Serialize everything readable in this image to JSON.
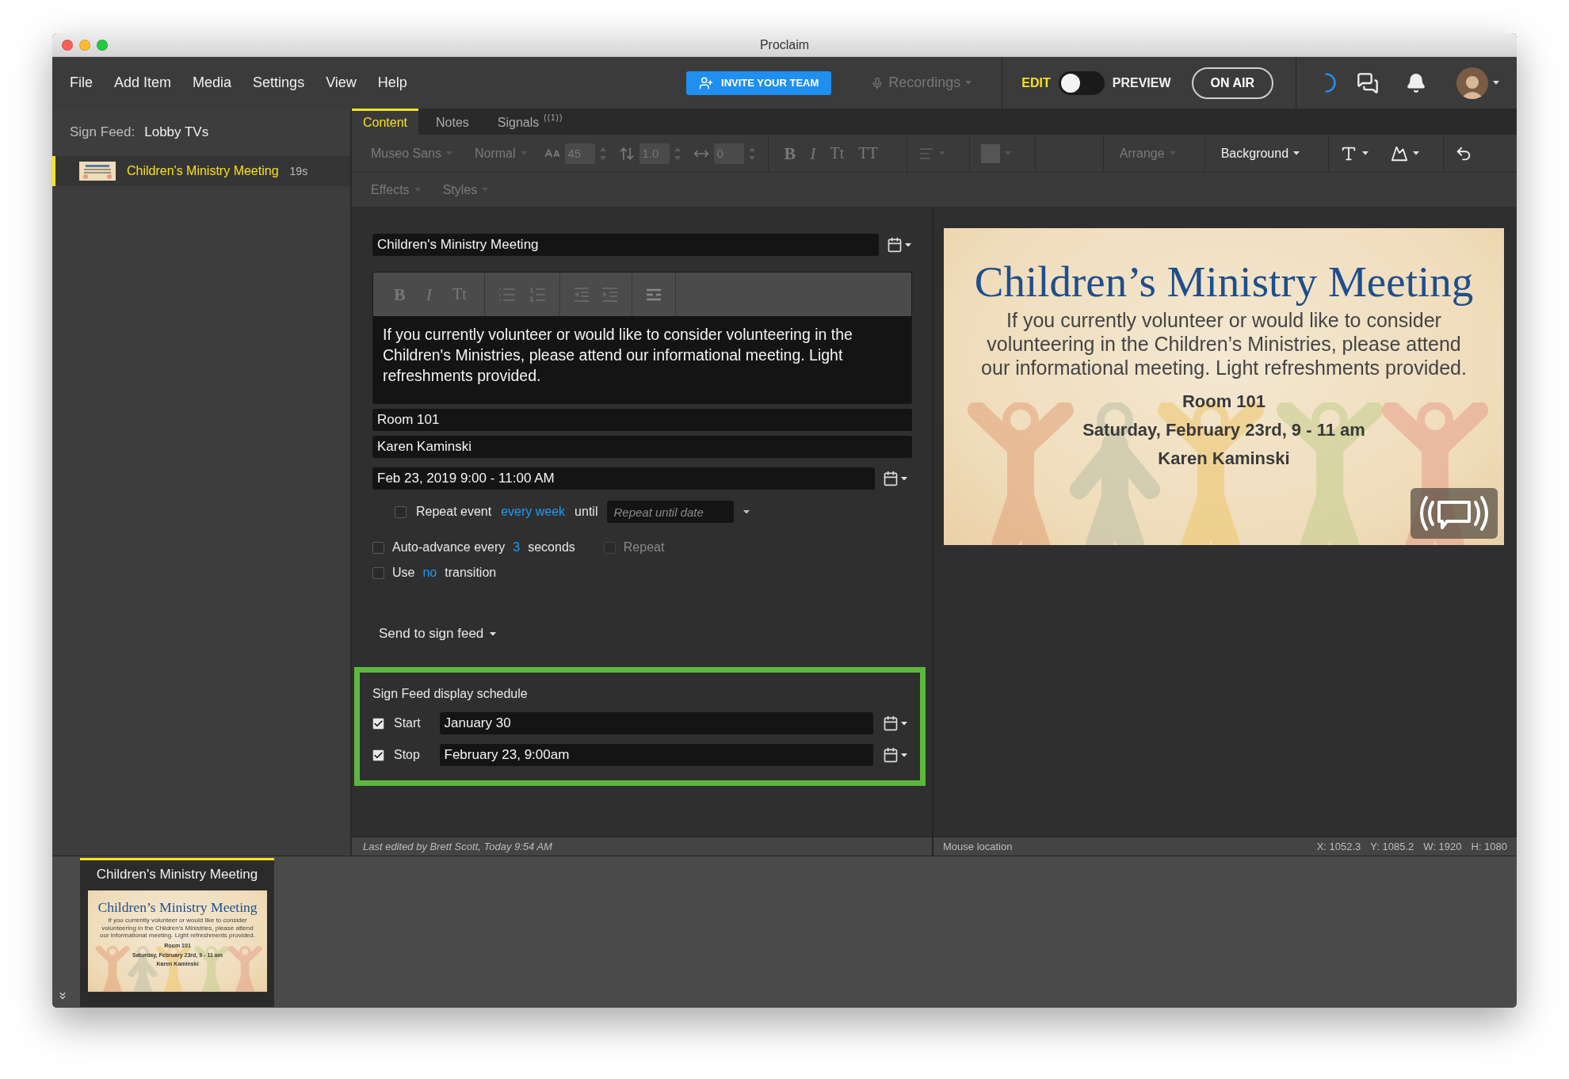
{
  "window": {
    "title": "Proclaim"
  },
  "menu": [
    "File",
    "Add Item",
    "Media",
    "Settings",
    "View",
    "Help"
  ],
  "toolbar": {
    "invite_button": "INVITE YOUR TEAM",
    "recordings": {
      "label": "Recordings",
      "disabled": true
    },
    "edit_label": "EDIT",
    "preview_label": "PREVIEW",
    "mode_toggle": {
      "preview": false
    },
    "on_air_button": "ON AIR"
  },
  "sidebar": {
    "feed_label": "Sign Feed:",
    "feed_name": "Lobby TVs",
    "items": [
      {
        "title": "Children's Ministry Meeting",
        "duration": "19s",
        "selected": true
      }
    ]
  },
  "tabs": [
    {
      "label": "Content",
      "selected": true
    },
    {
      "label": "Notes",
      "selected": false
    },
    {
      "label": "Signals",
      "badge": "((1))",
      "selected": false
    }
  ],
  "format_toolbar": {
    "disabled": true,
    "font": "Museo Sans",
    "weight": "Normal",
    "spinners": [
      {
        "value": "45"
      },
      {
        "value": "1.0"
      },
      {
        "value": "0"
      }
    ],
    "style_buttons": [
      "B",
      "I",
      "Tt",
      "TT"
    ],
    "arrange": "Arrange",
    "background": "Background",
    "effects": "Effects",
    "styles": "Styles"
  },
  "form": {
    "title": "Children's Ministry Meeting",
    "editor_buttons": [
      "B",
      "I",
      "Tt"
    ],
    "description": "If you currently volunteer or would like to consider volunteering in the Children's Ministries, please attend our informational meeting. Light refreshments provided.",
    "location": "Room 101",
    "contact": "Karen Kaminski",
    "datetime": "Feb 23, 2019 9:00 - 11:00 AM",
    "repeat": {
      "checked": false,
      "label": "Repeat event",
      "frequency": "every week",
      "until_label": "until",
      "until_placeholder": "Repeat until date"
    },
    "auto_advance": {
      "checked": false,
      "prefix": "Auto-advance every",
      "value": "3",
      "suffix": "seconds"
    },
    "loop": {
      "checked": false,
      "disabled": true,
      "label": "Repeat"
    },
    "transition": {
      "checked": false,
      "prefix": "Use",
      "value": "no",
      "suffix": "transition"
    },
    "send_button": "Send to sign feed"
  },
  "schedule": {
    "title": "Sign Feed display schedule",
    "rows": [
      {
        "label": "Start",
        "checked": true,
        "value": "January 30"
      },
      {
        "label": "Stop",
        "checked": true,
        "value": "February 23, 9:00am"
      }
    ]
  },
  "slide": {
    "title": "Children’s Ministry Meeting",
    "body": "If you currently volunteer or would like to consider volunteering in the Children’s Ministries, please attend our informational meeting. Light refreshments provided.",
    "lines": [
      "Room 101",
      "Saturday, February 23rd, 9 - 11 am",
      "Karen Kaminski"
    ]
  },
  "status_bar": {
    "last_edited": "Last edited by Brett Scott, Today 9:54 AM",
    "mouse_label": "Mouse location",
    "mouse_coords": [
      "X: 1052.3",
      "Y: 1085.2",
      "W: 1920",
      "H: 1080"
    ]
  },
  "filmstrip": [
    {
      "title": "Children's Ministry Meeting",
      "selected": true,
      "slide": {
        "title": "Children’s Ministry Meeting",
        "body": "If you currently volunteer or would like to consider volunteering in the Children’s Ministries, please attend our informational meeting. Light refreshments provided.",
        "lines": [
          "Room 101",
          "Saturday, February 23rd, 9 - 11 am",
          "Karen Kaminski"
        ]
      }
    }
  ]
}
